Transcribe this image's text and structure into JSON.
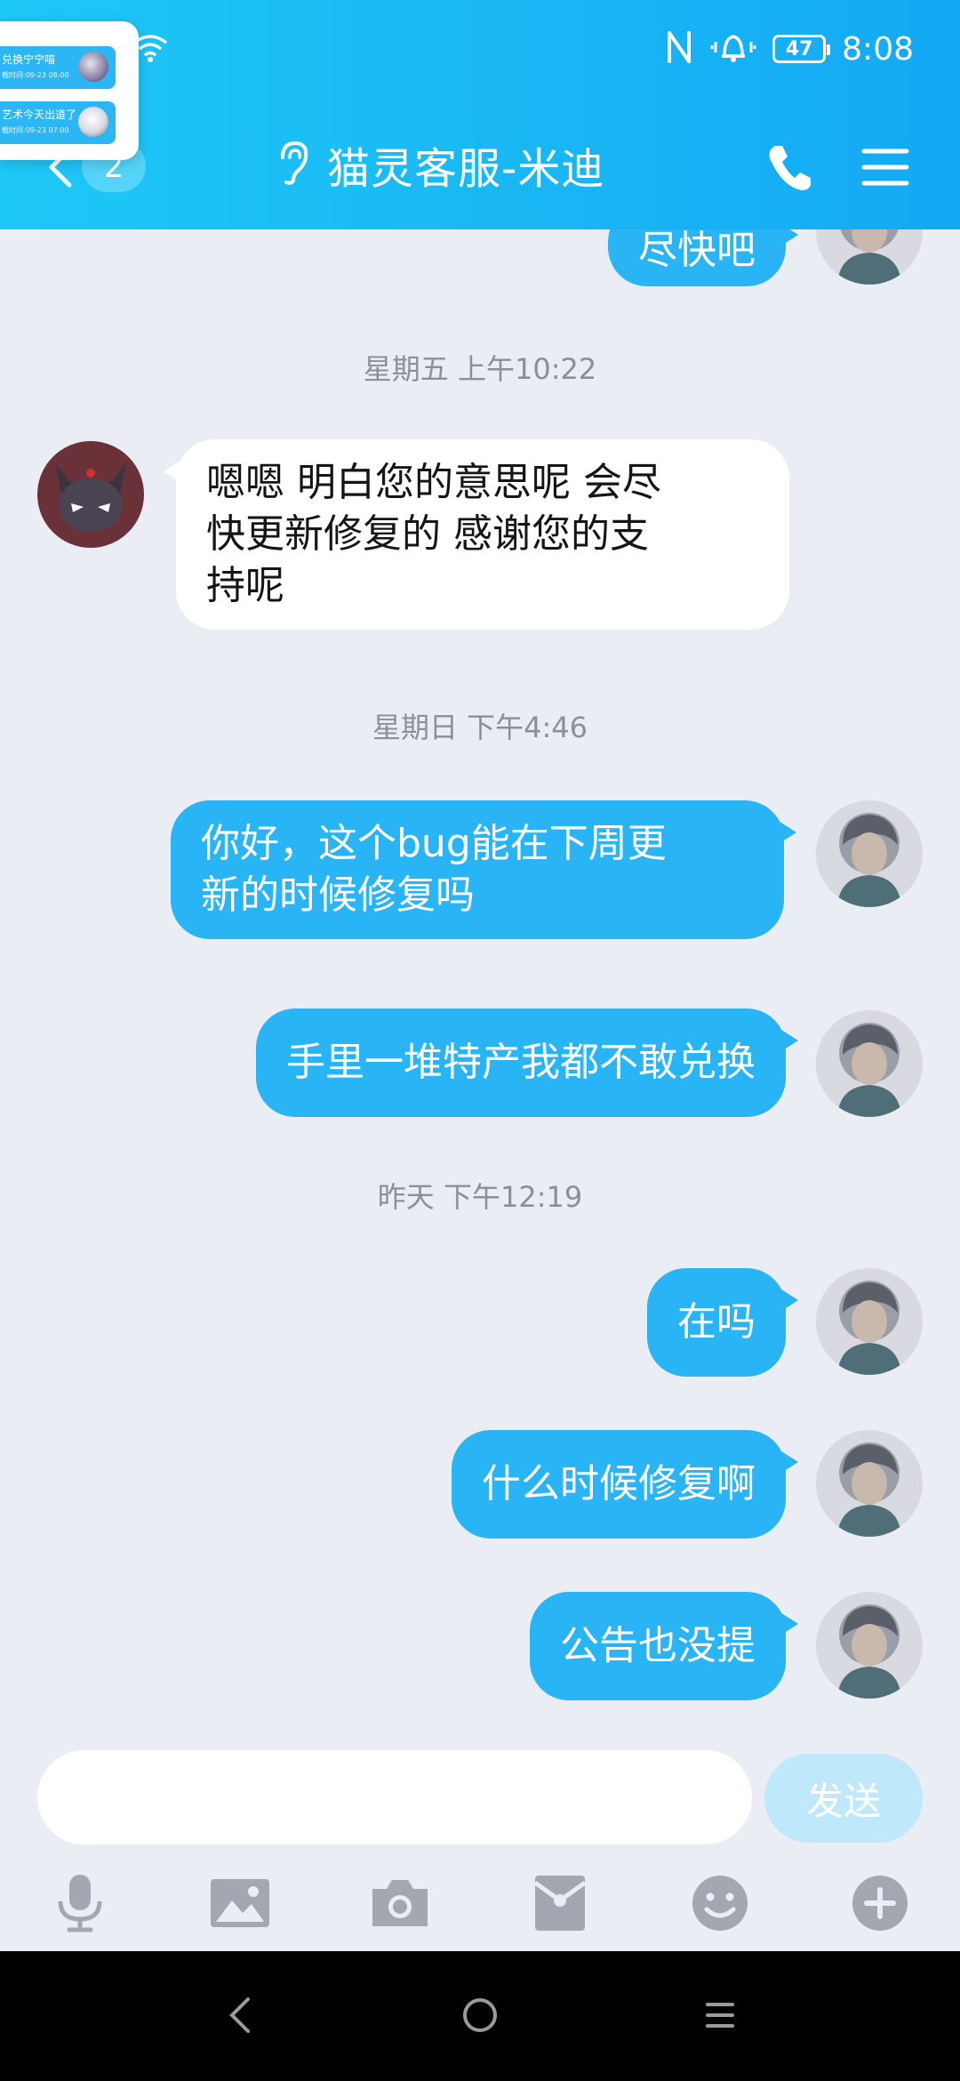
{
  "status_bar": {
    "battery_level": "47",
    "time": "8:08"
  },
  "header": {
    "unread_count": "2",
    "title": "猫灵客服-米迪"
  },
  "float_preview": {
    "items": [
      {
        "line1": "兑换宁宁喵",
        "line2": "截时间:09-23 08:00"
      },
      {
        "line1": "艺术今天出道了",
        "line2": "截时间:09-23 07:00"
      }
    ]
  },
  "messages": [
    {
      "type": "out",
      "text": "尽快吧"
    },
    {
      "type": "time",
      "text": "星期五 上午10:22"
    },
    {
      "type": "in",
      "lines": [
        "嗯嗯 明白您的意思呢 会尽",
        "快更新修复的 感谢您的支",
        "持呢"
      ]
    },
    {
      "type": "time",
      "text": "星期日 下午4:46"
    },
    {
      "type": "out",
      "lines": [
        "你好，这个bug能在下周更",
        "新的时候修复吗"
      ]
    },
    {
      "type": "out",
      "text": "手里一堆特产我都不敢兑换"
    },
    {
      "type": "time",
      "text": "昨天 下午12:19"
    },
    {
      "type": "out",
      "text": "在吗"
    },
    {
      "type": "out",
      "text": "什么时候修复啊"
    },
    {
      "type": "out",
      "text": "公告也没提"
    }
  ],
  "input": {
    "value": "",
    "send_label": "发送"
  },
  "toolbar": {
    "icons": [
      "microphone-icon",
      "image-icon",
      "camera-icon",
      "red-packet-icon",
      "emoji-icon",
      "plus-icon"
    ]
  },
  "colors": {
    "header_start": "#1ec8f6",
    "header_end": "#14a9f3",
    "bubble_out": "#28b4f5",
    "bubble_in": "#ffffff",
    "background": "#eaedf4",
    "send_disabled": "#bfe9fb"
  }
}
